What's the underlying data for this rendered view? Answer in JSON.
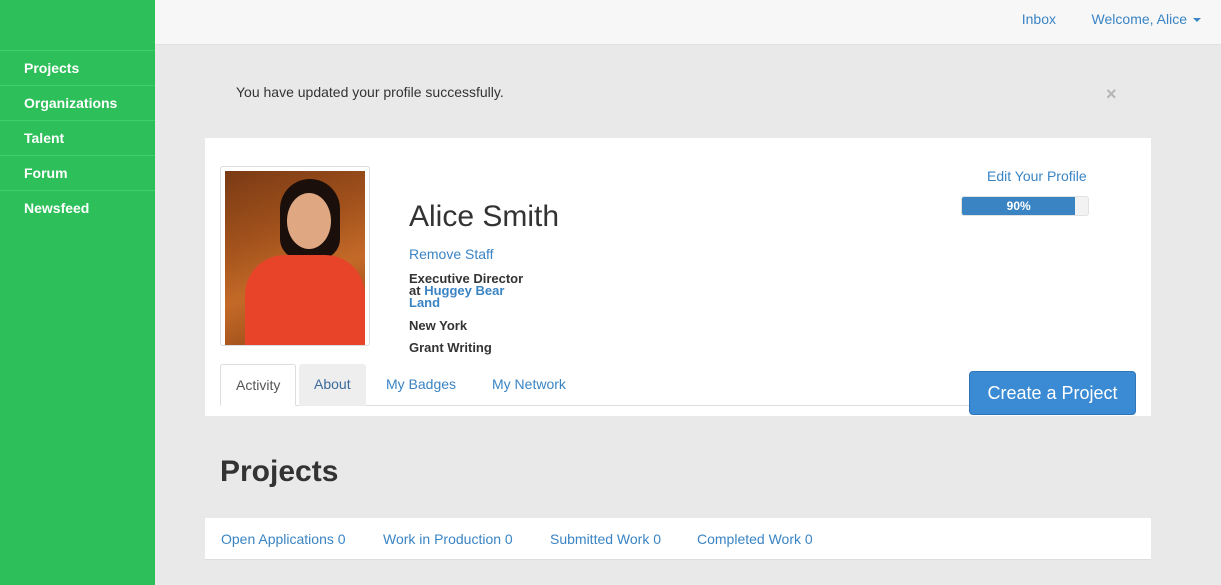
{
  "sidebar": {
    "items": [
      {
        "label": "Projects"
      },
      {
        "label": "Organizations"
      },
      {
        "label": "Talent"
      },
      {
        "label": "Forum"
      },
      {
        "label": "Newsfeed"
      }
    ]
  },
  "topbar": {
    "inbox": "Inbox",
    "welcome": "Welcome, Alice"
  },
  "alert": {
    "message": "You have updated your profile successfully.",
    "close": "×"
  },
  "profile": {
    "name": "Alice Smith",
    "remove_staff": "Remove Staff",
    "title": "Executive Director",
    "at": "at",
    "organization": "Huggey Bear Land",
    "location": "New York",
    "skill": "Grant Writing",
    "edit_profile": "Edit Your Profile",
    "completion_percent": 90,
    "completion_label": "90%"
  },
  "tabs": [
    {
      "label": "Activity"
    },
    {
      "label": "About"
    },
    {
      "label": "My Badges"
    },
    {
      "label": "My Network"
    }
  ],
  "create_project": "Create a Project",
  "projects": {
    "title": "Projects",
    "items": [
      {
        "label": "Open Applications 0"
      },
      {
        "label": "Work in Production 0"
      },
      {
        "label": "Submitted Work 0"
      },
      {
        "label": "Completed Work 0"
      }
    ]
  },
  "colors": {
    "sidebar": "#2dbf5a",
    "link": "#3a84c4",
    "button": "#3a8bd4"
  }
}
